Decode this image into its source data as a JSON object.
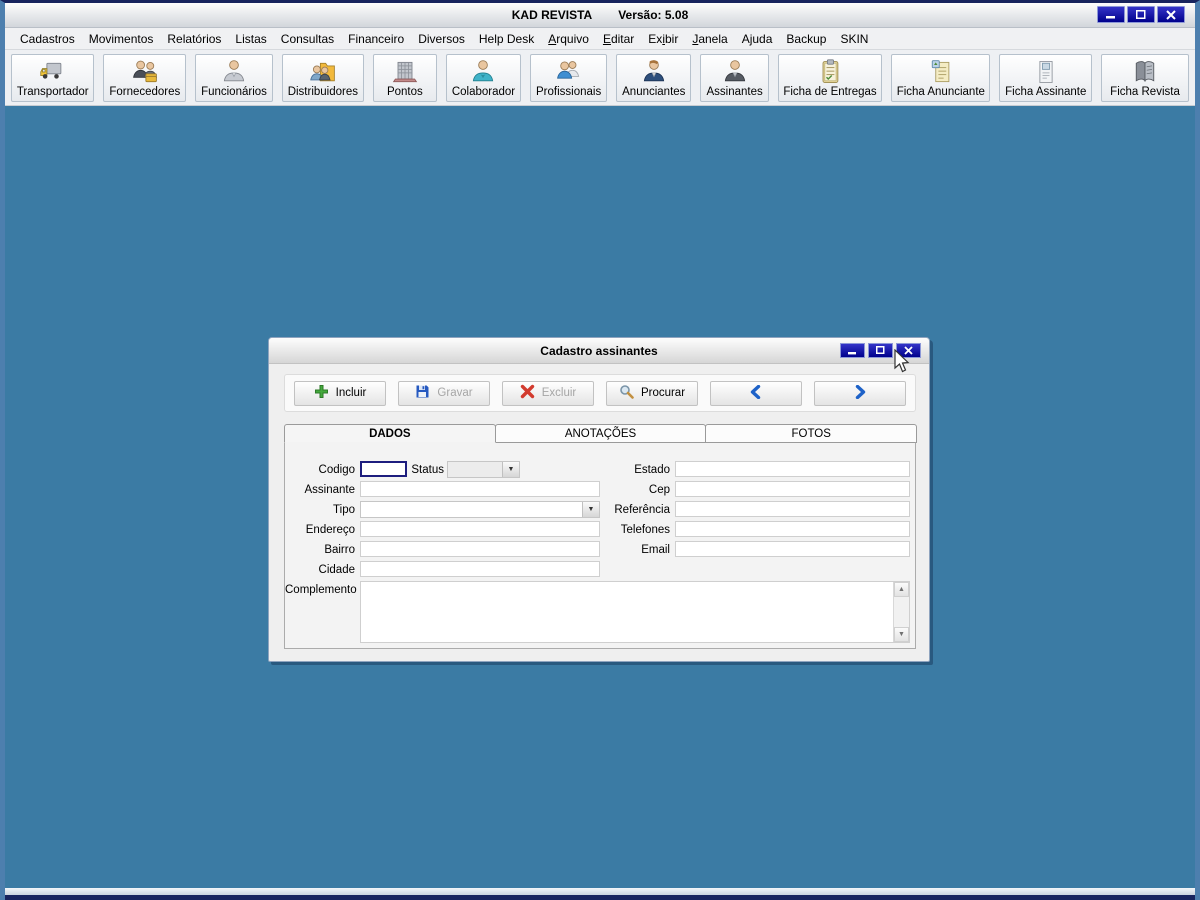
{
  "window": {
    "title": "KAD REVISTA",
    "version": "Versão: 5.08"
  },
  "menu": {
    "items": [
      {
        "label": "Cadastros",
        "u": -1
      },
      {
        "label": "Movimentos",
        "u": -1
      },
      {
        "label": "Relatórios",
        "u": -1
      },
      {
        "label": "Listas",
        "u": -1
      },
      {
        "label": "Consultas",
        "u": -1
      },
      {
        "label": "Financeiro",
        "u": -1
      },
      {
        "label": "Diversos",
        "u": -1
      },
      {
        "label": "Help Desk",
        "u": -1
      },
      {
        "label": "Arquivo",
        "u": 0
      },
      {
        "label": "Editar",
        "u": 0
      },
      {
        "label": "Exibir",
        "u": 2
      },
      {
        "label": "Janela",
        "u": 0
      },
      {
        "label": "Ajuda",
        "u": -1
      },
      {
        "label": "Backup",
        "u": -1
      },
      {
        "label": "SKIN",
        "u": -1
      }
    ]
  },
  "toolbar": {
    "buttons": [
      {
        "label": "Transportador",
        "icon": "truck-icon"
      },
      {
        "label": "Fornecedores",
        "icon": "suppliers-people-icon"
      },
      {
        "label": "Funcionários",
        "icon": "employee-person-icon"
      },
      {
        "label": "Distribuidores",
        "icon": "distributors-folder-icon"
      },
      {
        "label": "Pontos",
        "icon": "building-icon"
      },
      {
        "label": "Colaborador",
        "icon": "collaborator-person-icon"
      },
      {
        "label": "Profissionais",
        "icon": "professionals-people-icon"
      },
      {
        "label": "Anunciantes",
        "icon": "advertiser-person-icon"
      },
      {
        "label": "Assinantes",
        "icon": "subscriber-person-icon"
      },
      {
        "label": "Ficha de Entregas",
        "icon": "clipboard-icon"
      },
      {
        "label": "Ficha Anunciante",
        "icon": "document-yellow-icon"
      },
      {
        "label": "Ficha Assinante",
        "icon": "document-white-icon"
      },
      {
        "label": "Ficha Revista",
        "icon": "book-icon"
      }
    ]
  },
  "dialog": {
    "title": "Cadastro assinantes",
    "buttons": [
      {
        "label": "Incluir",
        "icon": "plus-icon",
        "enabled": true
      },
      {
        "label": "Gravar",
        "icon": "save-icon",
        "enabled": false
      },
      {
        "label": "Excluir",
        "icon": "delete-icon",
        "enabled": false
      },
      {
        "label": "Procurar",
        "icon": "search-icon",
        "enabled": true
      },
      {
        "label": "",
        "icon": "prev-icon",
        "enabled": true
      },
      {
        "label": "",
        "icon": "next-icon",
        "enabled": true
      }
    ],
    "tabs": [
      {
        "label": "DADOS",
        "active": true
      },
      {
        "label": "ANOTAÇÕES",
        "active": false
      },
      {
        "label": "FOTOS",
        "active": false
      }
    ],
    "form": {
      "labels": {
        "codigo": "Codigo",
        "status": "Status",
        "assinante": "Assinante",
        "tipo": "Tipo",
        "endereco": "Endereço",
        "bairro": "Bairro",
        "cidade": "Cidade",
        "complemento": "Complemento",
        "estado": "Estado",
        "cep": "Cep",
        "referencia": "Referência",
        "telefones": "Telefones",
        "email": "Email"
      },
      "values": {
        "codigo": "",
        "status": "",
        "assinante": "",
        "tipo": "",
        "endereco": "",
        "bairro": "",
        "cidade": "",
        "complemento": "",
        "estado": "",
        "cep": "",
        "referencia": "",
        "telefones": "",
        "email": ""
      }
    }
  },
  "colors": {
    "desktop": "#3b7ba4",
    "control_button": "#00008c",
    "focused_border": "#1d1d7e",
    "accent_green": "#44a93c",
    "accent_red": "#d23b2e",
    "accent_blue": "#1e62c8"
  }
}
